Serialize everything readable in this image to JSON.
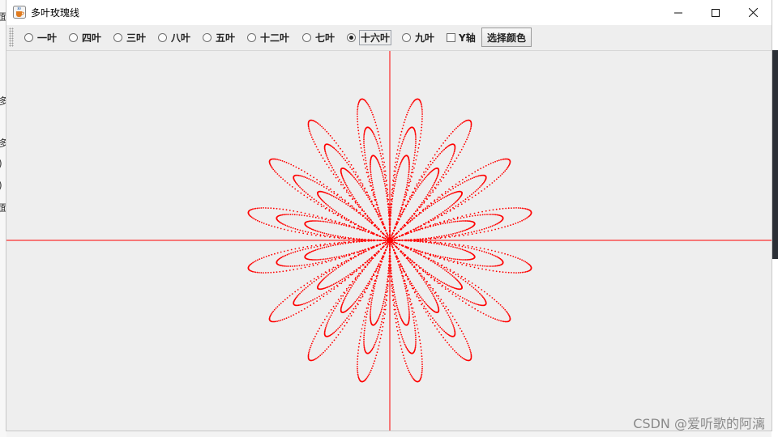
{
  "window": {
    "title": "多叶玫瑰线",
    "icon": "java-cup-icon"
  },
  "toolbar": {
    "options": [
      {
        "label": "一叶",
        "selected": false
      },
      {
        "label": "四叶",
        "selected": false
      },
      {
        "label": "三叶",
        "selected": false
      },
      {
        "label": "八叶",
        "selected": false
      },
      {
        "label": "五叶",
        "selected": false
      },
      {
        "label": "十二叶",
        "selected": false
      },
      {
        "label": "七叶",
        "selected": false
      },
      {
        "label": "十六叶",
        "selected": true
      },
      {
        "label": "九叶",
        "selected": false
      }
    ],
    "y_axis_label": "Y轴",
    "y_axis_checked": false,
    "color_button_label": "选择颜色"
  },
  "plot": {
    "curve_color": "#ff0000",
    "axis_color": "#ff0000",
    "petals": 16
  },
  "watermark": "CSDN @爱听歌的阿漓"
}
